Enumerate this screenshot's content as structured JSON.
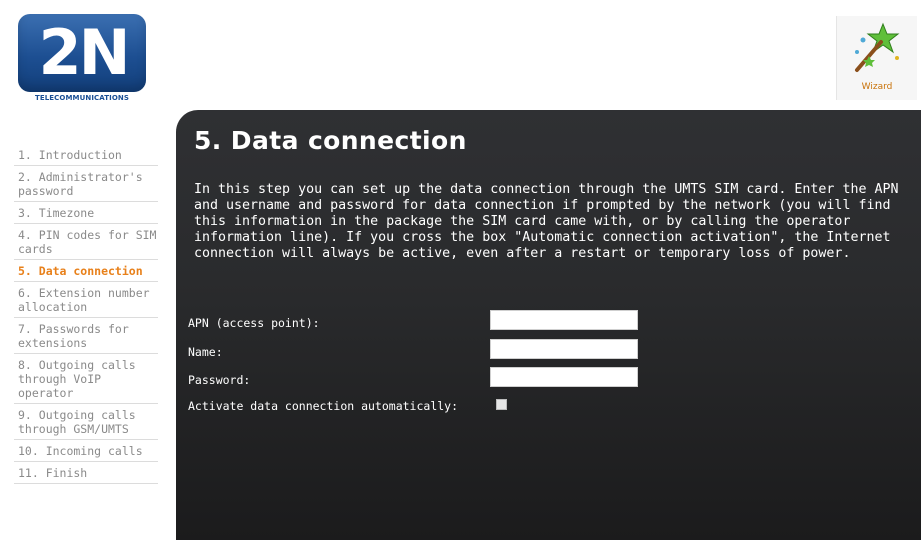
{
  "logo": {
    "main": "2N",
    "sub": "TELECOMMUNICATIONS"
  },
  "wizard": {
    "label": "Wizard",
    "icon": "magic-wand-icon",
    "accent": "#c9730a"
  },
  "sidebar": {
    "items": [
      {
        "label": "1. Introduction",
        "active": false
      },
      {
        "label": "2. Administrator's password",
        "active": false
      },
      {
        "label": "3. Timezone",
        "active": false
      },
      {
        "label": "4. PIN codes for SIM cards",
        "active": false
      },
      {
        "label": "5. Data connection",
        "active": true
      },
      {
        "label": "6. Extension number allocation",
        "active": false
      },
      {
        "label": "7. Passwords for extensions",
        "active": false
      },
      {
        "label": "8. Outgoing calls through VoIP operator",
        "active": false
      },
      {
        "label": "9. Outgoing calls through GSM/UMTS",
        "active": false
      },
      {
        "label": "10. Incoming calls",
        "active": false
      },
      {
        "label": "11. Finish",
        "active": false
      }
    ],
    "active_color": "#e8801a"
  },
  "main": {
    "title": "5. Data connection",
    "description": "In this step you can set up the data connection through the UMTS SIM card. Enter the APN and username and password for data connection if prompted by the network (you will find this information in the package the SIM card came with, or by calling the operator information line). If you cross the box \"Automatic connection activation\", the Internet connection will always be active, even after a restart or temporary loss of power."
  },
  "form": {
    "apn_label": "APN (access point):",
    "apn_value": "",
    "name_label": "Name:",
    "name_value": "",
    "password_label": "Password:",
    "password_value": "",
    "auto_label": "Activate data connection automatically:",
    "auto_checked": false
  }
}
